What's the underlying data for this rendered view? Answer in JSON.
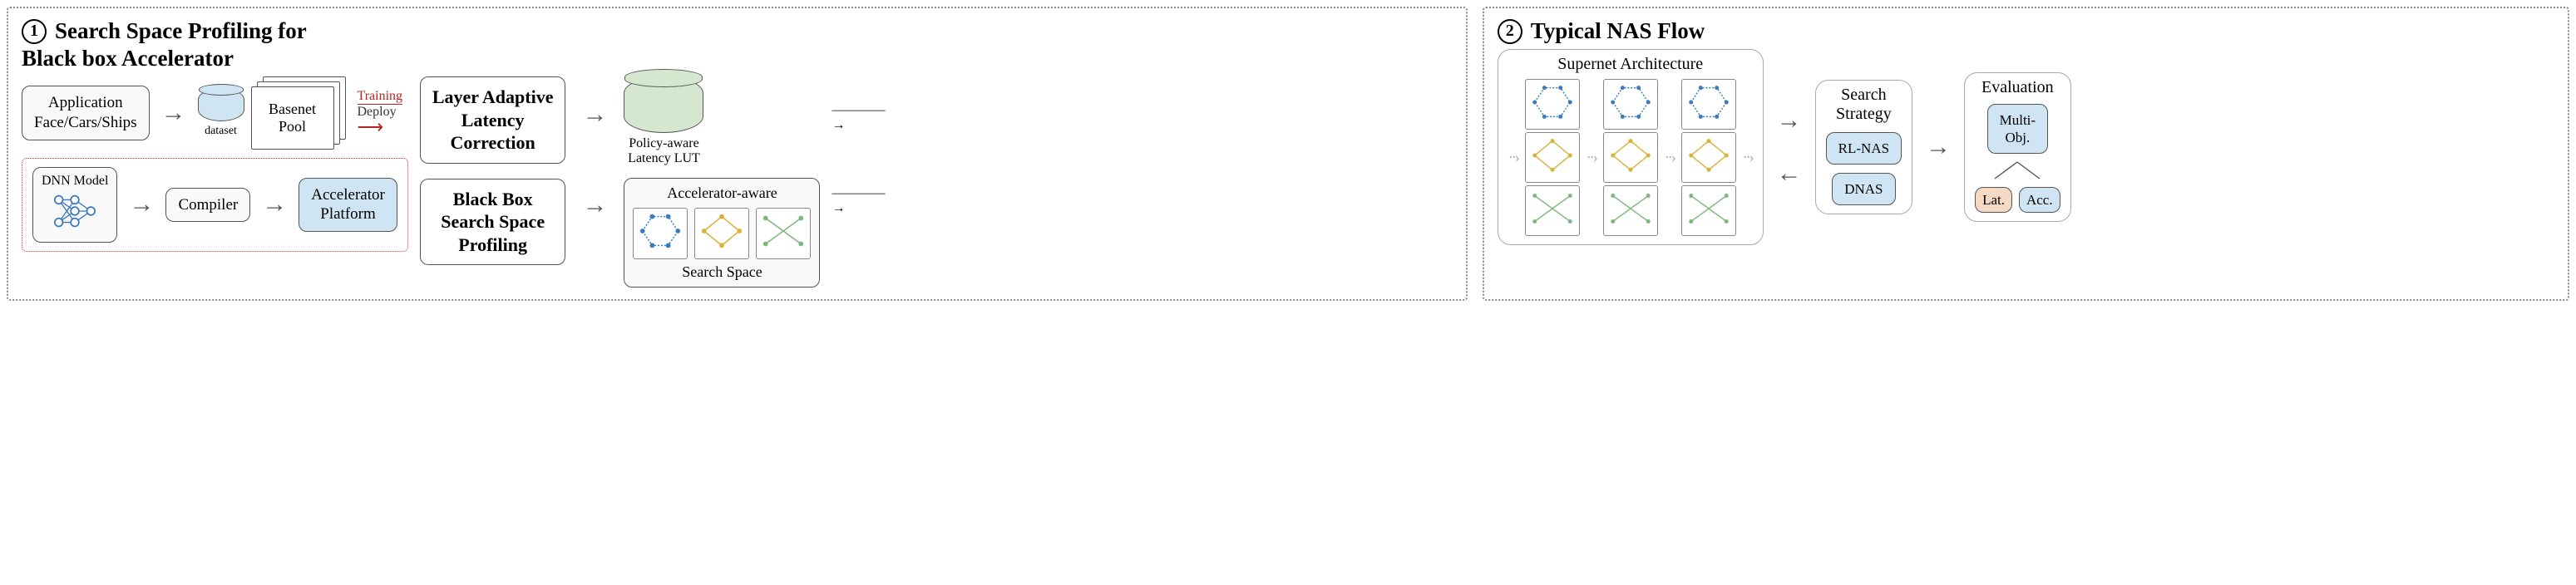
{
  "panels": {
    "one": {
      "num": "1",
      "title": "Search Space Profiling for",
      "subtitle": "Black box Accelerator"
    },
    "two": {
      "num": "2",
      "title": "Typical NAS Flow"
    }
  },
  "p1": {
    "application": "Application\nFace/Cars/Ships",
    "dataset_label": "dataset",
    "basenet_pool": "Basenet\nPool",
    "training": "Training",
    "deploy": "Deploy",
    "dnn_model": "DNN Model",
    "compiler": "Compiler",
    "accel_platform": "Accelerator\nPlatform",
    "layer_adaptive": "Layer Adaptive\nLatency\nCorrection",
    "lut_label": "Policy-aware\nLatency LUT",
    "blackbox_profiling": "Black Box\nSearch Space\nProfiling",
    "search_space_title": "Accelerator-aware",
    "search_space_sub": "Search Space"
  },
  "p2": {
    "supernet": "Supernet Architecture",
    "search_strategy": "Search\nStrategy",
    "rl": "RL-NAS",
    "dnas": "DNAS",
    "evaluation": "Evaluation",
    "multi": "Multi-\nObj.",
    "lat": "Lat.",
    "acc": "Acc."
  },
  "chart_data": {
    "type": "diagram",
    "pipeline": [
      {
        "stage": "Search Space Profiling for Black box Accelerator",
        "components": [
          {
            "id": "application",
            "label": "Application Face/Cars/Ships",
            "outputs": [
              "basenet-pool"
            ]
          },
          {
            "id": "dataset",
            "label": "dataset",
            "outputs": [
              "basenet-pool"
            ]
          },
          {
            "id": "basenet-pool",
            "label": "Basenet Pool",
            "outputs": [
              "dnn-model"
            ],
            "edge_label": "Training / Deploy"
          },
          {
            "id": "dnn-model",
            "label": "DNN Model",
            "outputs": [
              "compiler"
            ]
          },
          {
            "id": "compiler",
            "label": "Compiler",
            "outputs": [
              "accelerator-platform"
            ]
          },
          {
            "id": "accelerator-platform",
            "label": "Accelerator Platform"
          },
          {
            "id": "layer-adaptive-latency-correction",
            "label": "Layer Adaptive Latency Correction",
            "outputs": [
              "policy-aware-latency-lut"
            ]
          },
          {
            "id": "policy-aware-latency-lut",
            "label": "Policy-aware Latency LUT",
            "outputs": [
              "supernet-architecture"
            ]
          },
          {
            "id": "black-box-search-space-profiling",
            "label": "Black Box Search Space Profiling",
            "outputs": [
              "accelerator-aware-search-space"
            ]
          },
          {
            "id": "accelerator-aware-search-space",
            "label": "Accelerator-aware Search Space",
            "outputs": [
              "supernet-architecture"
            ]
          }
        ]
      },
      {
        "stage": "Typical NAS Flow",
        "components": [
          {
            "id": "supernet-architecture",
            "label": "Supernet Architecture",
            "outputs": [
              "search-strategy"
            ]
          },
          {
            "id": "search-strategy",
            "label": "Search Strategy",
            "options": [
              "RL-NAS",
              "DNAS"
            ],
            "outputs": [
              "evaluation"
            ],
            "bidirectional": true
          },
          {
            "id": "evaluation",
            "label": "Evaluation",
            "children": [
              "Multi-Obj.",
              "Lat.",
              "Acc."
            ]
          }
        ]
      }
    ]
  }
}
